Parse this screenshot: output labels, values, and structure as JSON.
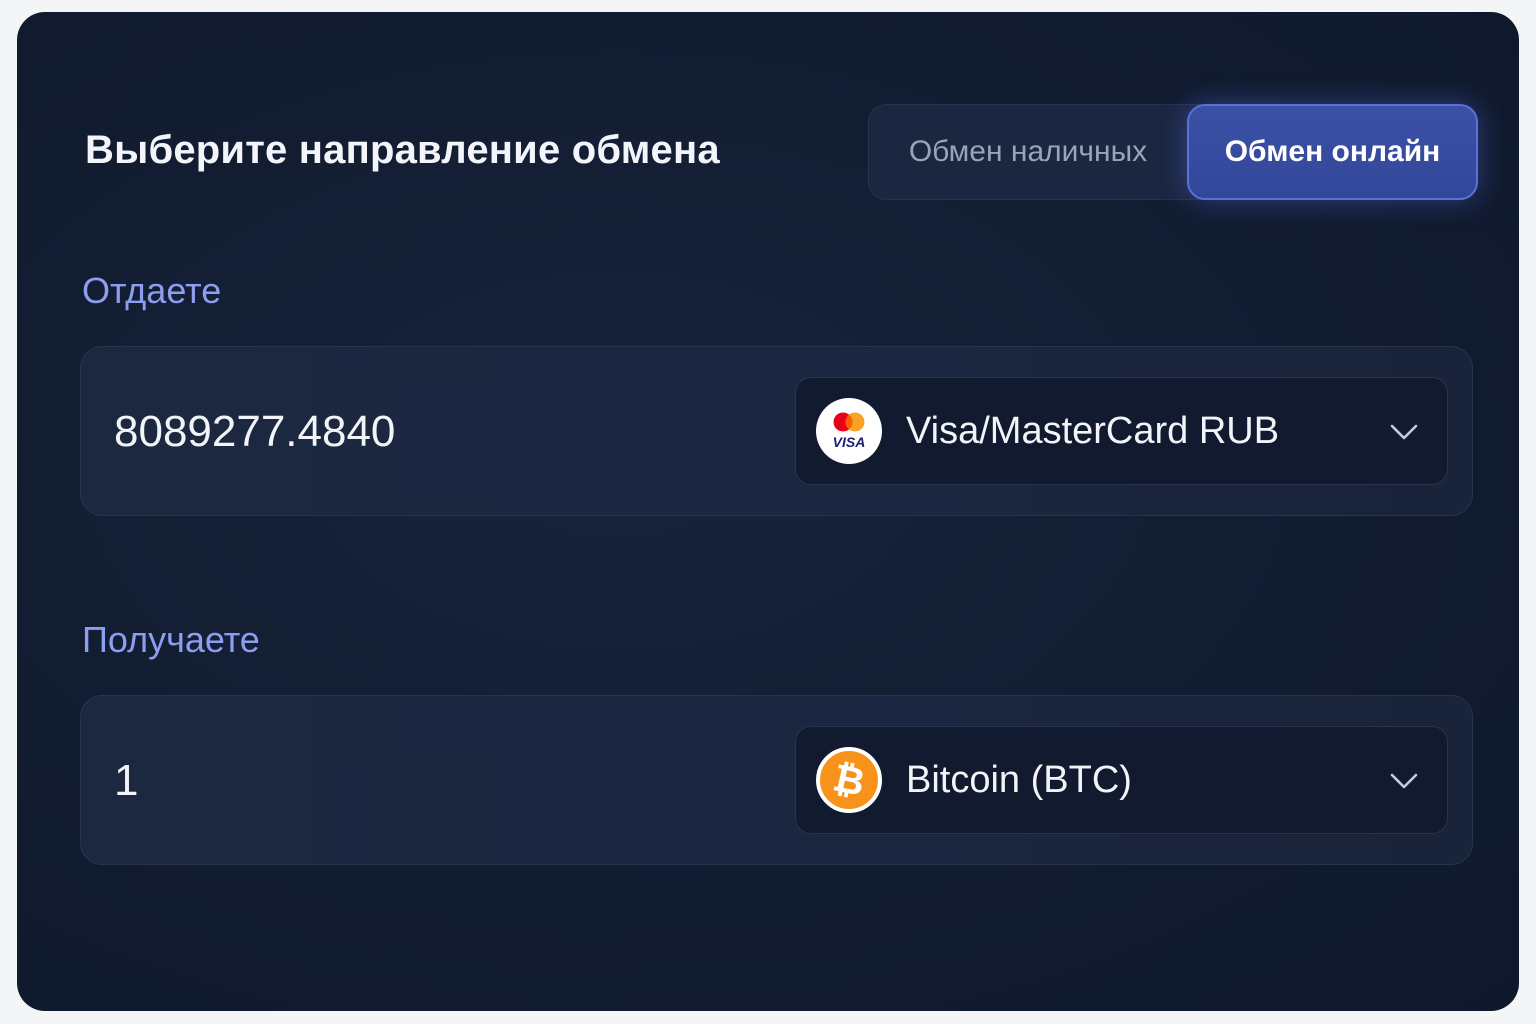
{
  "exchange": {
    "title": "Выберите направление обмена",
    "modes": {
      "cash_label": "Обмен наличных",
      "online_label": "Обмен онлайн",
      "active": "online"
    }
  },
  "give": {
    "label": "Отдаете",
    "amount": "8089277.4840",
    "currency": {
      "name": "Visa/MasterCard RUB",
      "icon": "visa-mastercard-icon"
    }
  },
  "receive": {
    "label": "Получаете",
    "amount": "1",
    "currency": {
      "name": "Bitcoin (BTC)",
      "icon": "bitcoin-icon"
    }
  },
  "colors": {
    "background": "#121c31",
    "accent": "#3b51a5",
    "label": "#8d9df0",
    "bitcoin": "#f7931a"
  }
}
